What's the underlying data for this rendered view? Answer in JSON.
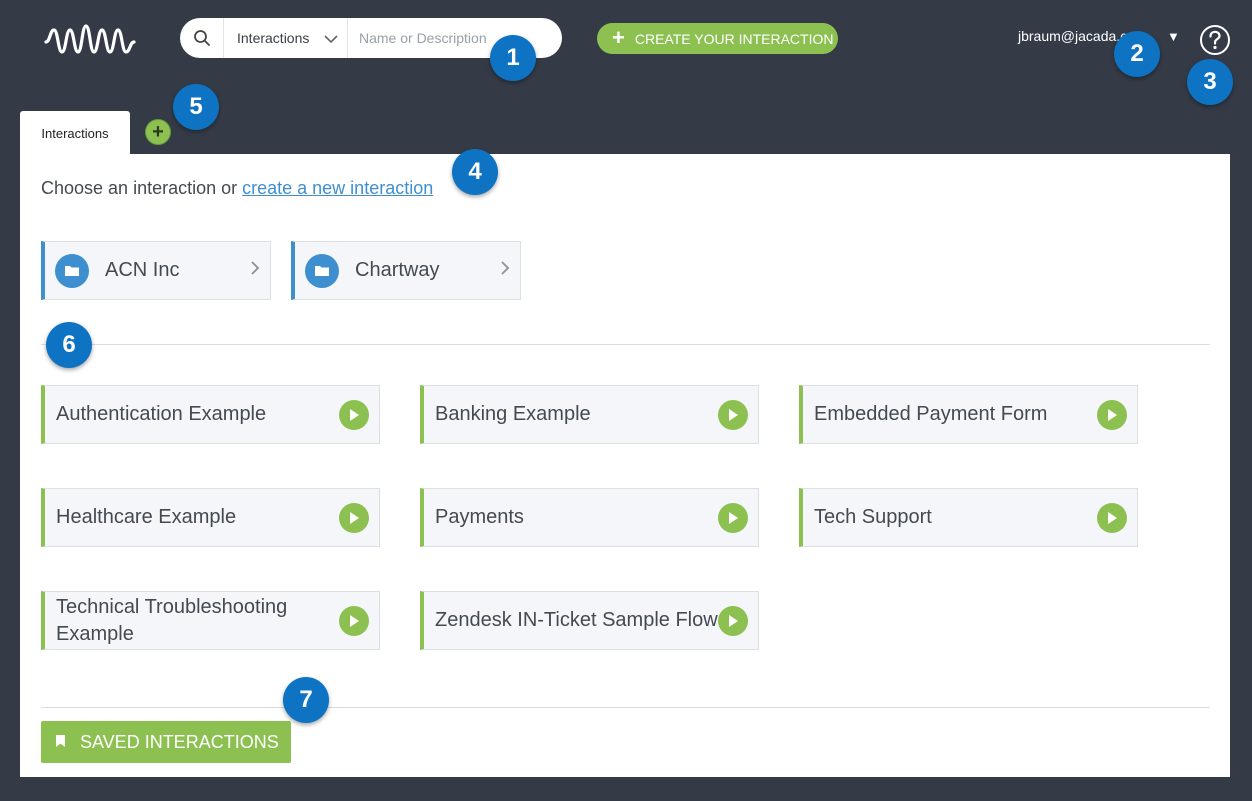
{
  "header": {
    "search": {
      "scope": "Interactions",
      "placeholder": "Name or Description",
      "value": ""
    },
    "create_label": "CREATE YOUR INTERACTION",
    "user_email": "jbraum@jacada.c",
    "caret": "▼"
  },
  "tabs": [
    {
      "label": "Interactions",
      "active": true
    }
  ],
  "add_tab_label": "+",
  "main": {
    "intro_text": "Choose an interaction or ",
    "intro_link": "create a new interaction",
    "folders": [
      {
        "label": "ACN Inc"
      },
      {
        "label": "Chartway"
      }
    ],
    "interactions": [
      {
        "label": "Authentication Example"
      },
      {
        "label": "Banking Example"
      },
      {
        "label": "Embedded Payment Form"
      },
      {
        "label": "Healthcare Example"
      },
      {
        "label": "Payments"
      },
      {
        "label": "Tech Support"
      },
      {
        "label": "Technical Troubleshooting Example"
      },
      {
        "label": "Zendesk IN-Ticket Sample Flow"
      }
    ],
    "saved_label": "SAVED INTERACTIONS"
  },
  "callouts": [
    "1",
    "2",
    "3",
    "4",
    "5",
    "6",
    "7"
  ],
  "colors": {
    "background": "#343b47",
    "accent_green": "#8cc152",
    "accent_blue": "#3e8fd0",
    "callout_blue": "#0e73c2"
  },
  "icons": {
    "logo": "waveform-logo",
    "search": "search-icon",
    "help": "help-icon",
    "folder": "folder-icon",
    "play": "play-icon",
    "bookmark": "bookmark-icon"
  }
}
